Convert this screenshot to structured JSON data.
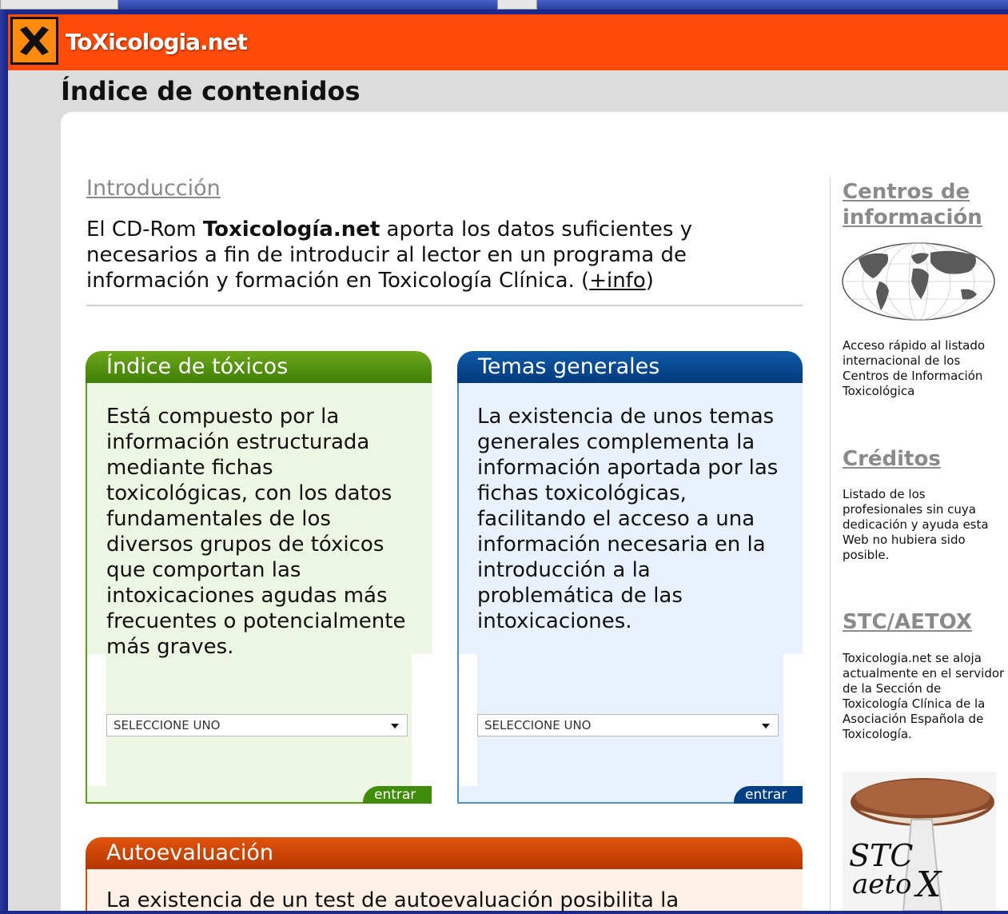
{
  "site": {
    "name": "ToXicologia.net",
    "page_title": "Índice de contenidos"
  },
  "intro": {
    "link": "Introducción",
    "text_before": "El CD-Rom ",
    "text_bold": "Toxicología.net",
    "text_after": " aporta los datos suficientes y necesarios a fin de introducir al lector en un programa de información y formación en Toxicología Clínica. (",
    "more_link": "+info",
    "text_close": ")"
  },
  "panels": [
    {
      "title": "Índice de tóxicos",
      "text": "Está compuesto por la información estructurada mediante fichas toxicológicas, con los datos fundamentales de los diversos grupos de tóxicos que comportan las intoxicaciones agudas más frecuentes o potencialmente más graves.",
      "select": "SELECCIONE UNO",
      "button": "entrar"
    },
    {
      "title": "Temas generales",
      "text": "La existencia de unos temas generales complementa la información aportada por las fichas toxicológicas, facilitando el acceso a una información necesaria en la introducción a la problemática de las intoxicaciones.",
      "select": "SELECCIONE UNO",
      "button": "entrar"
    }
  ],
  "autoevaluacion": {
    "title": "Autoevaluación",
    "text": "La existencia de un test de autoevaluación posibilita la"
  },
  "sidebar": {
    "centros": {
      "title": "Centros de información",
      "text": "Acceso rápido al listado internacional de los Centros de Información Toxicológica"
    },
    "creditos": {
      "title": "Créditos",
      "text": "Listado de los profesionales sin cuya dedicación y ayuda esta Web no hubiera sido posible."
    },
    "stc": {
      "title": "STC/AETOX",
      "text": "Toxicologia.net se aloja actualmente en el servidor de la Sección de Toxicología Clínica de la Asociación Española de Toxicología.",
      "logo_text": "STC aetoX"
    }
  },
  "colors": {
    "header": "#ff4b0a",
    "green": "#4f8f0c",
    "blue": "#023a7c",
    "orange": "#c9440a"
  }
}
